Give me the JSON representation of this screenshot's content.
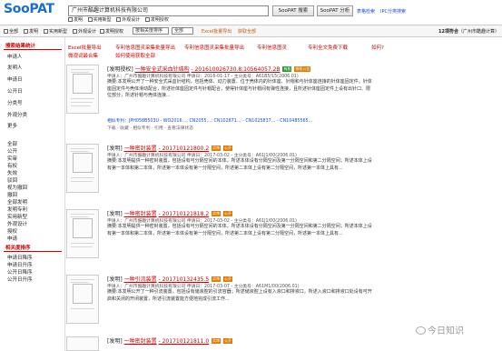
{
  "app": {
    "logo": "SooPAT"
  },
  "search": {
    "query": "广州市酷趣计算机科技有限公司"
  },
  "toolbar": {
    "search_button": "SooPAT 搜索",
    "analysis_button": "SooPAT 分析",
    "links": [
      "表格检索",
      "IPC分类搜索"
    ],
    "options": [
      "发明",
      "实用新型",
      "外观设计",
      "发明授权"
    ]
  },
  "filterbar": {
    "items": [
      "全部",
      "发明",
      "实用新型",
      "外观设计",
      "发明授权"
    ],
    "sort_select": "按相关度排序",
    "range_select": "全部",
    "export_label": "Excel批量导出",
    "order_label": "获取全部",
    "result_count_prefix": "12项符合",
    "result_count_query": "广州市酷趣计算"
  },
  "sidebar": {
    "title": "搜索结果统计",
    "main_items": [
      "申请人",
      "发明人",
      "申请日",
      "公开日",
      "分类号",
      "外观分类",
      "更多"
    ],
    "groups": [
      "全部",
      "公开",
      "实审",
      "有权",
      "失效",
      "驳回",
      "视为撤回",
      "撤回",
      "全部发明",
      "发明专利",
      "实用新型",
      "外观设计",
      "授权",
      "申请"
    ],
    "related_title": "相关度排序",
    "related_items": [
      "申请日降序",
      "申请日升序",
      "公开日降序",
      "公开日升序"
    ]
  },
  "actions": {
    "row1": [
      "Excel批量导出",
      "专利信息图灵采集批量导出",
      "专利信息图灵采集批量导出",
      "专利信息图灵",
      "专利全文免费下载",
      "如何?"
    ],
    "row2": [
      "微观词最合集",
      "如何使用获取全部"
    ]
  },
  "results": [
    {
      "type": "[发明授权]",
      "title": "一种安全式采血针结构",
      "number": "- 201610026730.8;10564057.2B",
      "badges": [
        "有权",
        "授权公告"
      ],
      "meta": "申请人：广州市酷趣计算机科技有限公司   申请日：2016-01-17 - 主分类号：A61B5/15(2006.01)",
      "abstract": "摘要:本发明公开了一种安全式采血针结构，包括壳体、动力装置、位于壳体内的针体座、针帽和与针体座连接的针体座固定件，针体座固定件与壳体滑动配合，所述针体座固定件与针帽配合，使得针体座与针帽间有弹性连接，且所述针体座固定件上设有出针口、限位部分，所述针帽与壳体连接...",
      "cite": "相似专利：JPH058B503U - WO2016…; CN2055…; CN102871… - CN1025837… - CN10485565…",
      "foot": "下载 · 收藏 · 相似专利 · 引用 · 查看法律状态"
    },
    {
      "type": "[发明]",
      "title": "一种密封装置",
      "number": "- 201710121800.2",
      "badges": [
        "实审",
        "公开"
      ],
      "meta": "申请人：广州市酷趣计算机科技有限公司   申请日：2017-03-02 - 主分类号：A61J1/00(2006.01)",
      "abstract": "摘要:本发明提供一种密封装置，包括设有可分隔空间的本体，所述本体设有分隔空间及第一分隔空间和第二分隔空间；所述本体上设有第一本体和第二本体，所述第一本体设有第一分隔空间，所述第二本体上设有第二分隔空间，所述第一本体上具有..."
    },
    {
      "type": "[发明]",
      "title": "一种密封装置",
      "number": "- 201710121818.2",
      "badges": [
        "实审",
        "公开"
      ],
      "meta": "申请人：广州市酷趣计算机科技有限公司   申请日：2017-03-02 - 主分类号：A61J1/00(2006.01)",
      "abstract": "摘要:本发明提供一种密封装置，包括设有可分隔空间的本体，所述本体设有分隔空间及第一分隔空间和第二分隔空间；所述本体上设有第一本体和第二本体，所述第一本体设有第一分隔空间，所述第二本体上设有第二分隔空间，所述第一本体上具有..."
    },
    {
      "type": "[发明]",
      "title": "一种引流装置",
      "number": "- 201710132435.5",
      "badges": [
        "实审",
        "公开"
      ],
      "meta": "申请人：广州市酷趣计算机科技有限公司   申请日：2017-03-07 - 主分类号：A61M1/00(2006.01)",
      "abstract": "摘要:本发明公开了一种引流装置，包括设有储液腔的引流容器；所述储液腔上设有入液口和排液口，所述入液口和排液口处设有可开启和关闭的开闭装置，所述引流装置能方便地完成引流工作..."
    },
    {
      "type": "[发明]",
      "title": "一种密封装置",
      "number": "- 201710121811.0",
      "badges": [
        "实审",
        "公开"
      ],
      "meta": "",
      "abstract": ""
    }
  ],
  "watermark": "今日知识"
}
